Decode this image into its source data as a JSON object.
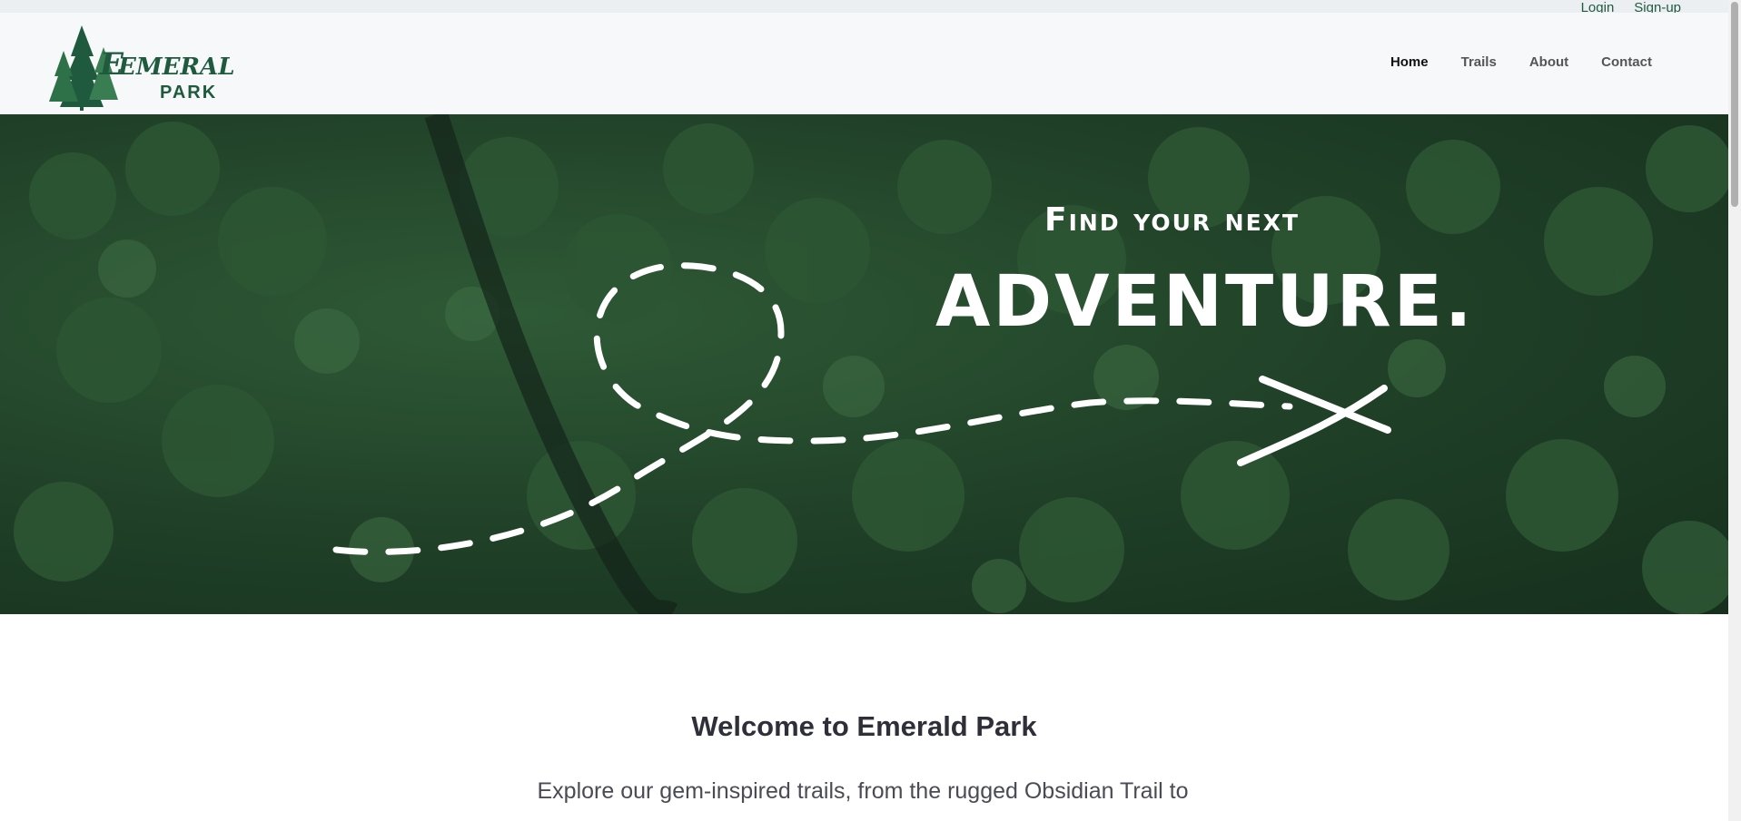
{
  "brand": {
    "name_line1": "EMERALD",
    "name_line2": "PARK",
    "accent_color": "#1f5a3f",
    "logo_icon": "pine-trees-icon"
  },
  "util_links": {
    "login": "Login",
    "signup": "Sign-up"
  },
  "nav": {
    "items": [
      {
        "label": "Home",
        "active": true
      },
      {
        "label": "Trails",
        "active": false
      },
      {
        "label": "About",
        "active": false
      },
      {
        "label": "Contact",
        "active": false
      }
    ]
  },
  "hero": {
    "line1": "Find your next",
    "line2": "ADVENTURE."
  },
  "welcome": {
    "title": "Welcome to Emerald Park",
    "body": "Explore our gem-inspired trails, from the rugged Obsidian Trail to"
  }
}
